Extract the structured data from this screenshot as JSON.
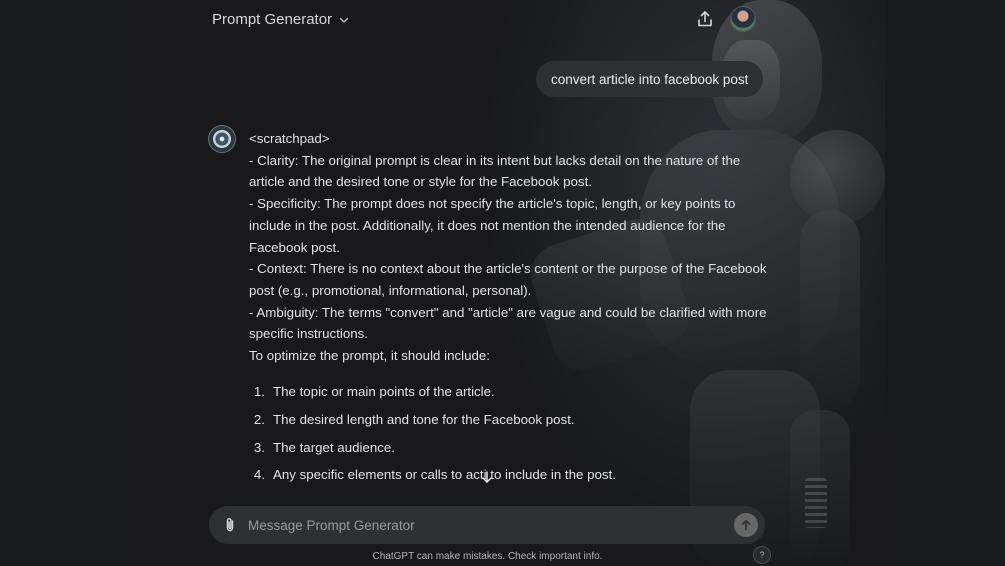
{
  "header": {
    "title": "Prompt Generator"
  },
  "user_message": "convert article into facebook post",
  "assistant": {
    "paragraphs": [
      "<scratchpad>",
      "- Clarity: The original prompt is clear in its intent but lacks detail on the nature of the article and the desired tone or style for the Facebook post.",
      "- Specificity: The prompt does not specify the article's topic, length, or key points to include in the post. Additionally, it does not mention the intended audience for the Facebook post.",
      "- Context: There is no context about the article's content or the purpose of the Facebook post (e.g., promotional, informational, personal).",
      "- Ambiguity: The terms \"convert\" and \"article\" are vague and could be clarified with more specific instructions.",
      "To optimize the prompt, it should include:"
    ],
    "list": [
      {
        "num": "1.",
        "text": "The topic or main points of the article."
      },
      {
        "num": "2.",
        "text": "The desired length and tone for the Facebook post."
      },
      {
        "num": "3.",
        "text": "The target audience."
      },
      {
        "num": "4.",
        "text": "Any specific elements or calls to acti  to include in the post."
      }
    ]
  },
  "composer": {
    "placeholder": "Message Prompt Generator"
  },
  "footer": {
    "disclaimer": "ChatGPT can make mistakes. Check important info.",
    "help": "?"
  },
  "icons": {
    "share": "share-icon",
    "attach": "paperclip-icon",
    "send": "arrow-up-icon",
    "scroll": "arrow-down-icon",
    "dropdown": "chevron-down-icon"
  }
}
